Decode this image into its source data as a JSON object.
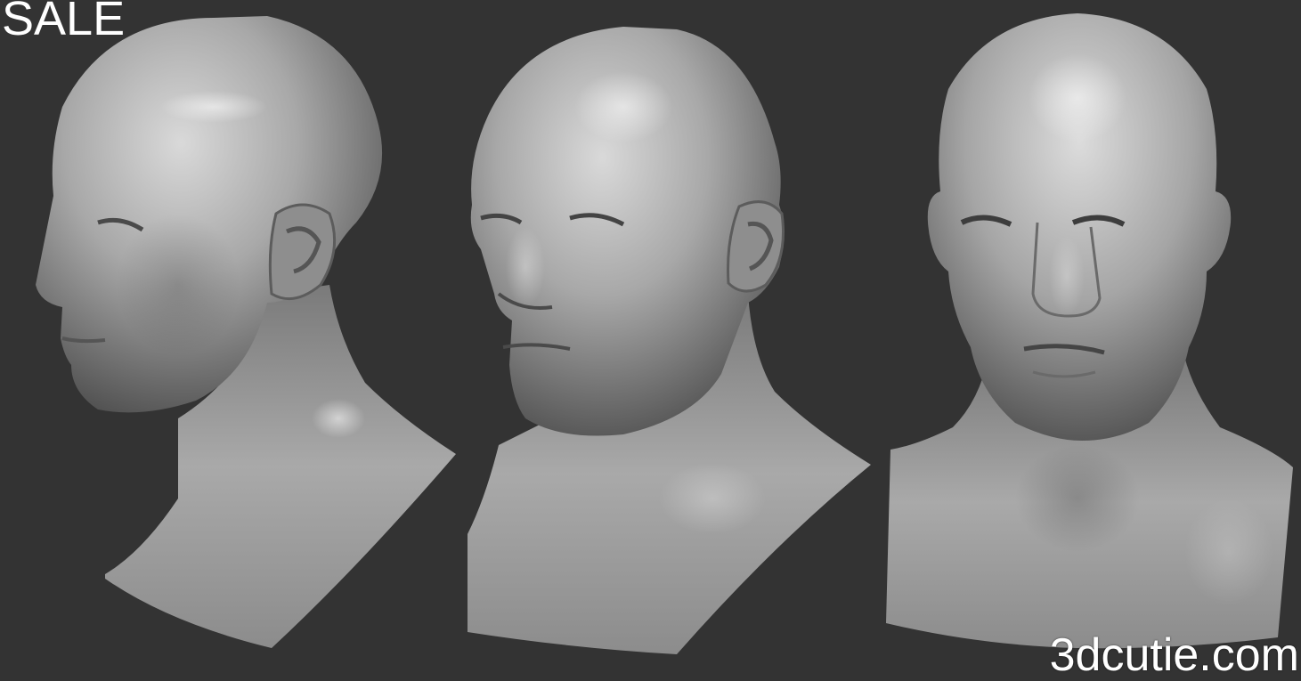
{
  "overlay": {
    "sale_label": "SALE",
    "watermark": "3dcutie.com"
  },
  "scene": {
    "background_color": "#333333",
    "sculpt_color": "#9a9a9a",
    "views": [
      "left-three-quarter-head",
      "three-quarter-head",
      "front-head"
    ]
  }
}
